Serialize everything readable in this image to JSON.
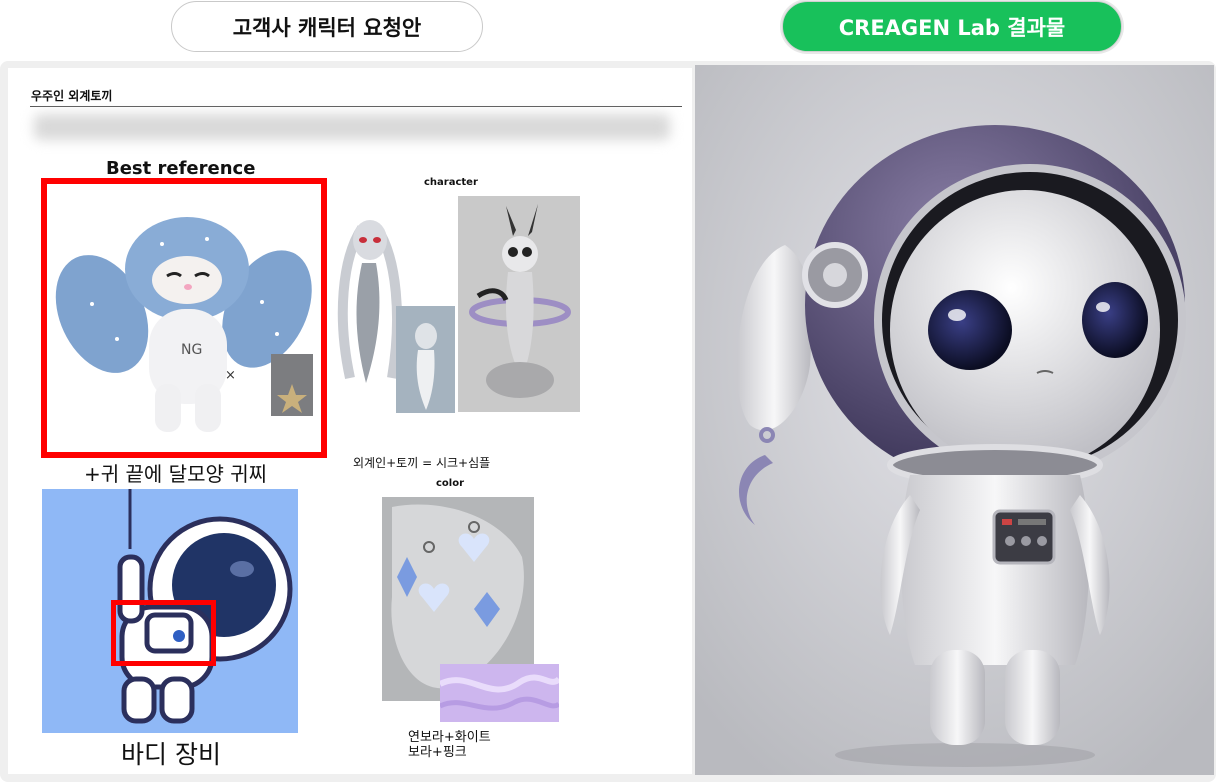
{
  "header": {
    "left_pill": "고객사 캐릭터 요청안",
    "right_pill": "CREAGEN Lab 결과물"
  },
  "document": {
    "title": "우주인 외계토끼",
    "best_reference_label": "Best reference",
    "character_label": "character",
    "ear_note": "+귀 끝에 달모양 귀찌",
    "alien_note": "외계인+토끼 = 시크+심플",
    "color_label": "color",
    "body_note": "바디 장비",
    "palette_note_line1": "연보라+화이트",
    "palette_note_line2": "보라+핑크"
  },
  "colors": {
    "accent_green": "#18c15b",
    "highlight_red": "#ff0000",
    "astronaut_bg": "#8fb8f6"
  }
}
